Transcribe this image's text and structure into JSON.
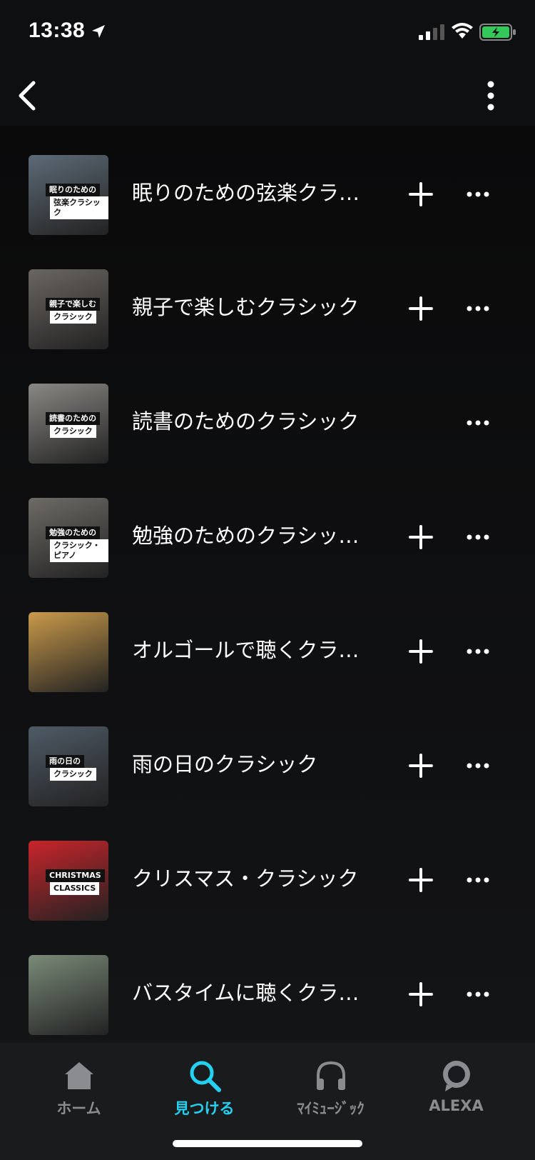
{
  "status_bar": {
    "time": "13:38"
  },
  "items": [
    {
      "title": "眠りのための弦楽クラ…",
      "thumb_line1": "眠りのための",
      "thumb_line2": "弦楽クラシック",
      "show_add": true,
      "thumb_color": "#5d6a76"
    },
    {
      "title": "親子で楽しむクラシック",
      "thumb_line1": "親子で楽しむ",
      "thumb_line2": "クラシック",
      "show_add": true,
      "thumb_color": "#6a6560"
    },
    {
      "title": "読書のためのクラシック",
      "thumb_line1": "読書のための",
      "thumb_line2": "クラシック",
      "show_add": false,
      "thumb_color": "#8a8884"
    },
    {
      "title": "勉強のためのクラシッ…",
      "thumb_line1": "勉強のための",
      "thumb_line2": "クラシック・ピアノ",
      "show_add": true,
      "thumb_color": "#6e6b66"
    },
    {
      "title": "オルゴールで聴くクラ…",
      "thumb_line1": "",
      "thumb_line2": "",
      "show_add": true,
      "thumb_color": "#c99a4a"
    },
    {
      "title": "雨の日のクラシック",
      "thumb_line1": "雨の日の",
      "thumb_line2": "クラシック",
      "show_add": true,
      "thumb_color": "#4f5a66"
    },
    {
      "title": "クリスマス・クラシック",
      "thumb_line1": "CHRISTMAS",
      "thumb_line2": "CLASSICS",
      "show_add": true,
      "thumb_color": "#c8242a"
    },
    {
      "title": "バスタイムに聴くクラ…",
      "thumb_line1": "",
      "thumb_line2": "",
      "show_add": true,
      "thumb_color": "#7a8a78"
    }
  ],
  "tabs": [
    {
      "label": "ホーム",
      "icon": "home-icon",
      "active": false
    },
    {
      "label": "見つける",
      "icon": "search-icon",
      "active": true
    },
    {
      "label": "ﾏｲﾐｭｰｼﾞｯｸ",
      "icon": "headphones-icon",
      "active": false
    },
    {
      "label": "ALEXA",
      "icon": "alexa-icon",
      "active": false
    }
  ],
  "colors": {
    "accent": "#25d1f0",
    "inactive_tab": "#8a8c90",
    "background": "#0d0e10"
  }
}
